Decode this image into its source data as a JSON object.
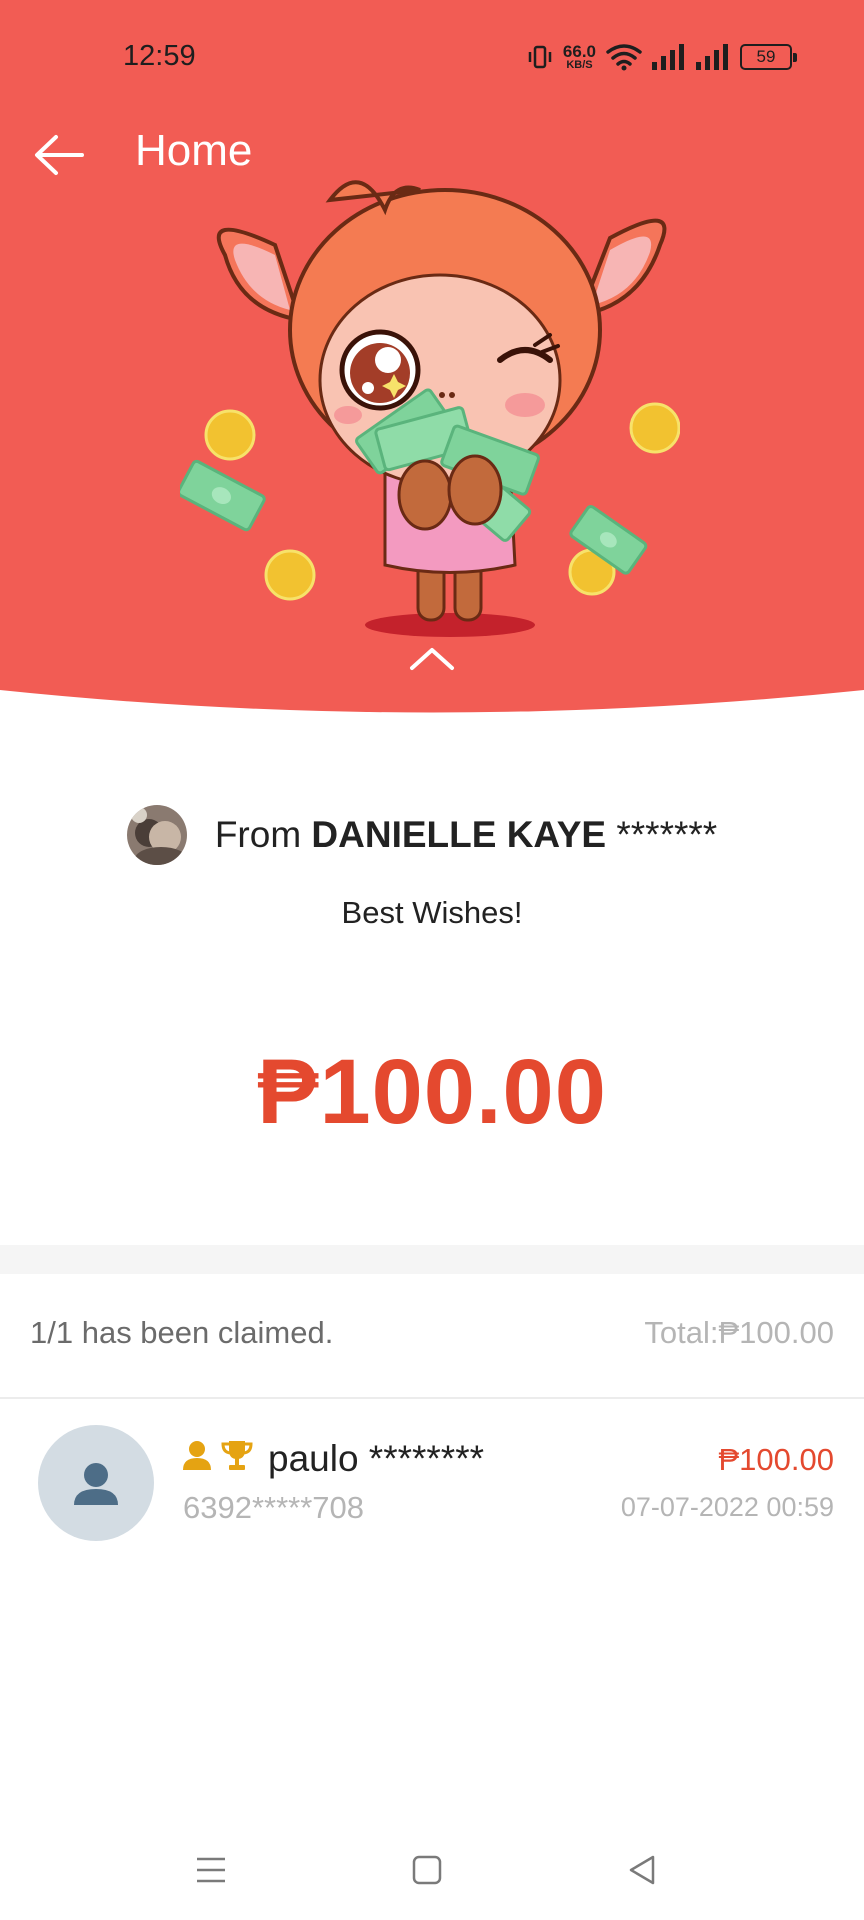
{
  "status_bar": {
    "time": "12:59",
    "net_speed_value": "66.0",
    "net_speed_unit": "KB/S",
    "battery": "59"
  },
  "header": {
    "title": "Home",
    "background_color": "#f25c54"
  },
  "gift": {
    "from_prefix": "From ",
    "sender_name": "DANIELLE KAYE",
    "sender_masked": " *******",
    "message": "Best Wishes!",
    "amount": "₱100.00",
    "amount_color": "#e4492f"
  },
  "claims": {
    "summary": "1/1 has been claimed.",
    "total": "Total:₱100.00",
    "items": [
      {
        "name": "paulo ********",
        "phone": "6392*****708",
        "amount": "₱100.00",
        "timestamp": "07-07-2022 00:59",
        "badges": [
          "user-icon",
          "trophy-icon"
        ]
      }
    ]
  },
  "nav": {
    "buttons": [
      "menu-icon",
      "home-icon",
      "back-triangle-icon"
    ]
  }
}
